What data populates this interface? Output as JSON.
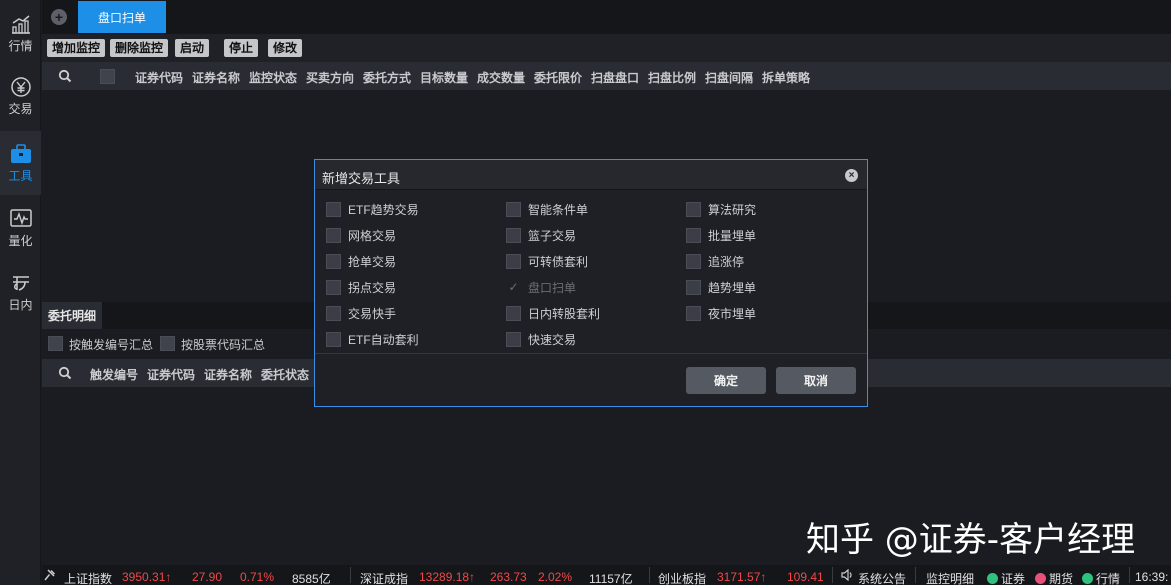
{
  "sidebar": {
    "items": [
      {
        "label": "行情",
        "icon": "chart-line-icon"
      },
      {
        "label": "交易",
        "icon": "yen-circle-icon"
      },
      {
        "label": "工具",
        "icon": "briefcase-icon",
        "active": true
      },
      {
        "label": "量化",
        "icon": "pulse-monitor-icon"
      },
      {
        "label": "日内",
        "icon": "intraday-icon"
      }
    ]
  },
  "tabs": {
    "active_tab": "盘口扫单"
  },
  "toolbar": {
    "buttons": [
      "增加监控",
      "删除监控",
      "启动",
      "停止",
      "修改"
    ]
  },
  "monitor_table": {
    "columns": [
      "证券代码",
      "证券名称",
      "监控状态",
      "买卖方向",
      "委托方式",
      "目标数量",
      "成交数量",
      "委托限价",
      "扫盘盘口",
      "扫盘比例",
      "扫盘间隔",
      "拆单策略"
    ]
  },
  "lower_panel": {
    "tab": "委托明细",
    "options": [
      "按触发编号汇总",
      "按股票代码汇总"
    ],
    "columns": [
      "触发编号",
      "证券代码",
      "证券名称",
      "委托状态"
    ]
  },
  "dialog": {
    "title": "新增交易工具",
    "options": [
      {
        "label": "ETF趋势交易",
        "checked": false,
        "disabled": false
      },
      {
        "label": "网格交易",
        "checked": false,
        "disabled": false
      },
      {
        "label": "抢单交易",
        "checked": false,
        "disabled": false
      },
      {
        "label": "拐点交易",
        "checked": false,
        "disabled": false
      },
      {
        "label": "交易快手",
        "checked": false,
        "disabled": false
      },
      {
        "label": "ETF自动套利",
        "checked": false,
        "disabled": false
      },
      {
        "label": "智能条件单",
        "checked": false,
        "disabled": false
      },
      {
        "label": "篮子交易",
        "checked": false,
        "disabled": false
      },
      {
        "label": "可转债套利",
        "checked": false,
        "disabled": false
      },
      {
        "label": "盘口扫单",
        "checked": true,
        "disabled": true
      },
      {
        "label": "日内转股套利",
        "checked": false,
        "disabled": false
      },
      {
        "label": "快速交易",
        "checked": false,
        "disabled": false
      },
      {
        "label": "算法研究",
        "checked": false,
        "disabled": false
      },
      {
        "label": "批量埋单",
        "checked": false,
        "disabled": false
      },
      {
        "label": "追涨停",
        "checked": false,
        "disabled": false
      },
      {
        "label": "趋势埋单",
        "checked": false,
        "disabled": false
      },
      {
        "label": "夜市埋单",
        "checked": false,
        "disabled": false
      }
    ],
    "confirm": "确定",
    "cancel": "取消"
  },
  "statusbar": {
    "sh": {
      "name": "上证指数",
      "value": "3950.31↑",
      "change": "27.90",
      "pct": "0.71%",
      "amount": "8585亿"
    },
    "sz": {
      "name": "深证成指",
      "value": "13289.18↑",
      "change": "263.73",
      "pct": "2.02%",
      "amount": "11157亿"
    },
    "cy": {
      "name": "创业板指",
      "value": "3171.57↑",
      "change": "109.41"
    },
    "announcement": "系统公告",
    "monitor": "监控明细",
    "conn": [
      {
        "label": "证券",
        "color": "#2ec27e"
      },
      {
        "label": "期货",
        "color": "#e8507a"
      },
      {
        "label": "行情",
        "color": "#2ec27e"
      }
    ],
    "time": "16:39:"
  },
  "watermark": "知乎 @证券-客户经理",
  "colors": {
    "accent": "#1e8fe6",
    "up": "#f04848"
  }
}
